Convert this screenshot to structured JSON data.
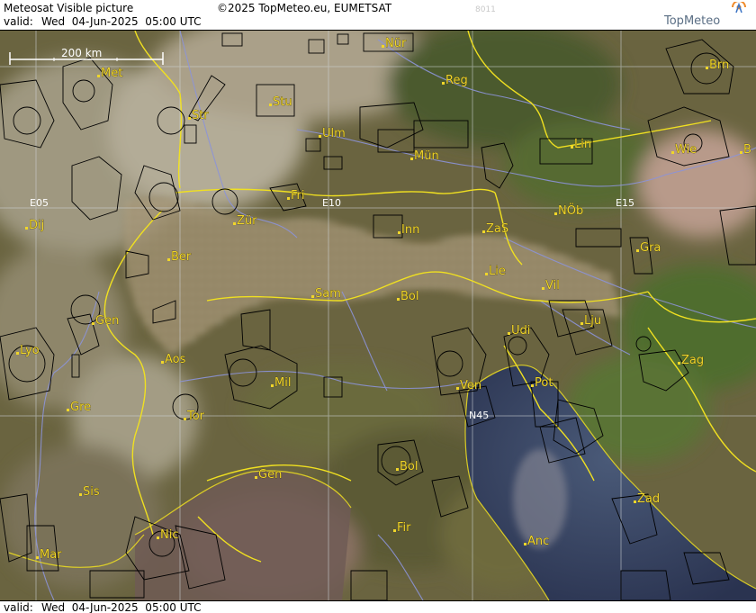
{
  "header": {
    "title": "Meteosat Visible picture",
    "copyright": "©2025 TopMeteo.eu, EUMETSAT",
    "image_code": "8011",
    "valid_label": "valid:",
    "valid_time": "Wed  04-Jun-2025  05:00 UTC"
  },
  "footer": {
    "valid_label": "valid:",
    "valid_time": "Wed  04-Jun-2025  05:00 UTC"
  },
  "logo": {
    "text": "TopMeteo",
    "icon": "topmeteo-logo-icon"
  },
  "scale_bar": {
    "label": "200 km"
  },
  "grid_labels": [
    "E05",
    "E10",
    "E15",
    "N45"
  ],
  "cities": [
    "Met",
    "Nür",
    "Reg",
    "Brn",
    "Str",
    "Stu",
    "Ulm",
    "Mün",
    "Lin",
    "Wie",
    "B",
    "Fri",
    "Zür",
    "Inn",
    "ZaS",
    "NÖb",
    "Dij",
    "Ber",
    "Gra",
    "Lie",
    "Sam",
    "Bol",
    "Vil",
    "Gen",
    "Lju",
    "Udi",
    "Lyo",
    "Aos",
    "Zag",
    "Mil",
    "Ven",
    "Pot",
    "Gre",
    "Tor",
    "Gen",
    "Bol",
    "Zad",
    "Sis",
    "Fir",
    "Nic",
    "Anc",
    "Mar"
  ],
  "colors": {
    "border": "#f0e020",
    "river": "#8c93d8",
    "airspace": "#000000",
    "grid": "#cfd4d8",
    "city": "#f0d62a"
  }
}
